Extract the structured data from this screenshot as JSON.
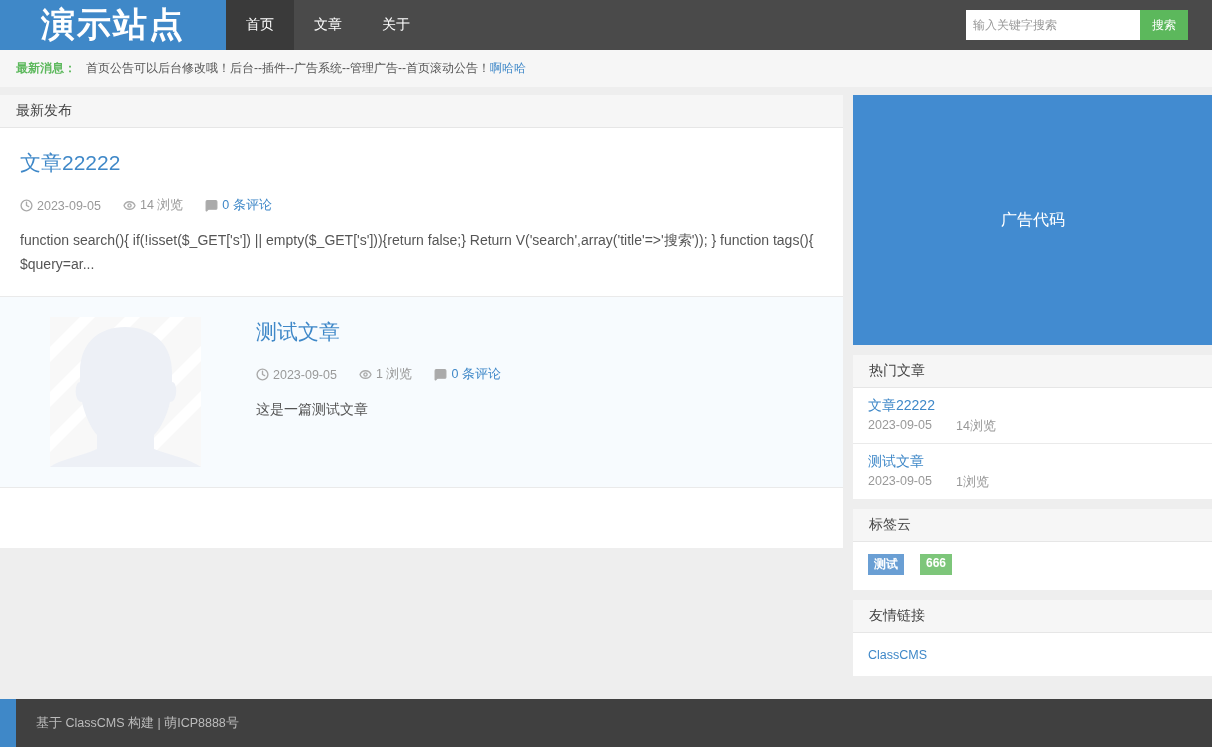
{
  "header": {
    "logo": "演示站点",
    "nav": [
      {
        "label": "首页",
        "selected": true
      },
      {
        "label": "文章",
        "selected": false
      },
      {
        "label": "关于",
        "selected": false
      }
    ],
    "search": {
      "placeholder": "输入关键字搜索",
      "button": "搜索"
    }
  },
  "notice": {
    "label": "最新消息：",
    "text": "首页公告可以后台修改哦！后台--插件--广告系统--管理广告--首页滚动公告！",
    "link": "啊哈哈"
  },
  "latest": {
    "title": "最新发布",
    "articles": [
      {
        "kind": "text",
        "title": "文章22222",
        "date": "2023-09-05",
        "views": "14 浏览",
        "comments": "0 条评论",
        "excerpt": "function search(){ if(!isset($_GET['s']) || empty($_GET['s'])){return false;} Return V('search',array('title'=>'搜索')); } function tags(){ $query=ar..."
      },
      {
        "kind": "thumbnail",
        "title": "测试文章",
        "date": "2023-09-05",
        "views": "1 浏览",
        "comments": "0 条评论",
        "excerpt": "这是一篇测试文章"
      }
    ]
  },
  "ad": {
    "text": "广告代码"
  },
  "hot": {
    "title": "热门文章",
    "items": [
      {
        "title": "文章22222",
        "date": "2023-09-05",
        "views": "14浏览"
      },
      {
        "title": "测试文章",
        "date": "2023-09-05",
        "views": "1浏览"
      }
    ]
  },
  "tags": {
    "title": "标签云",
    "items": [
      {
        "label": "测试",
        "color": "#6a9fd4"
      },
      {
        "label": "666",
        "color": "#7dc67a"
      }
    ]
  },
  "links": {
    "title": "友情链接",
    "items": [
      "ClassCMS"
    ]
  },
  "footer": {
    "text": "基于 ClassCMS 构建 | 萌ICP8888号"
  }
}
